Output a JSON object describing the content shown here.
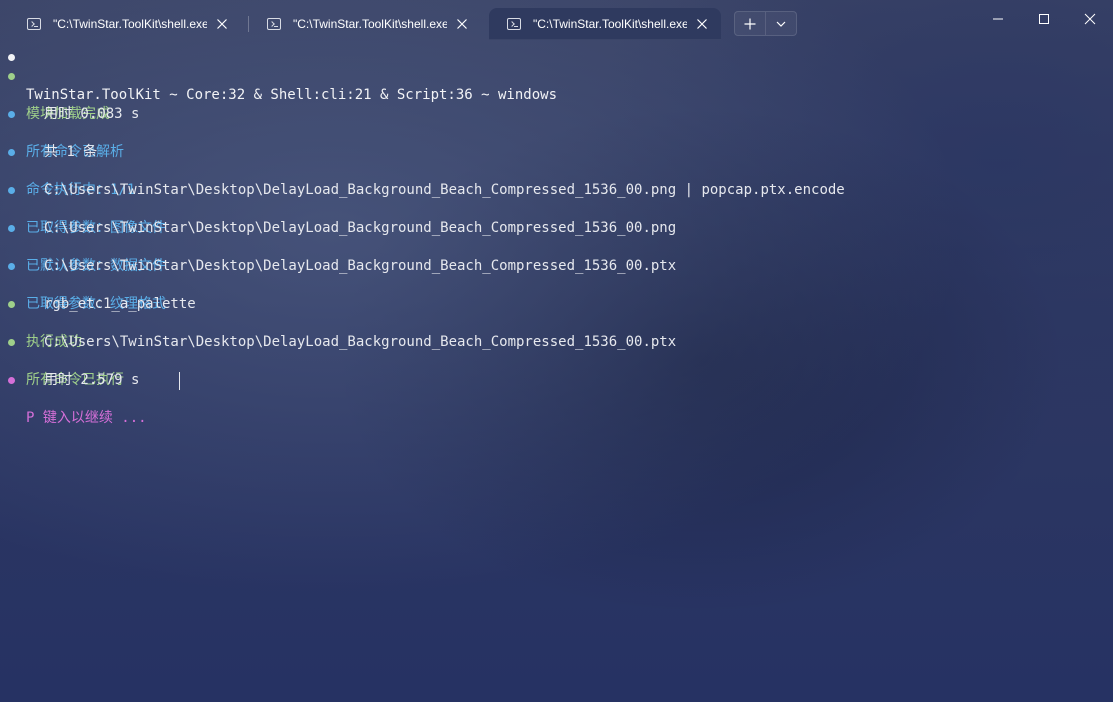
{
  "window": {
    "tabs": [
      {
        "title": "\"C:\\TwinStar.ToolKit\\shell.exe\"",
        "active": false
      },
      {
        "title": "\"C:\\TwinStar.ToolKit\\shell.exe\"",
        "active": false
      },
      {
        "title": "\"C:\\TwinStar.ToolKit\\shell.exe\"",
        "active": true
      }
    ],
    "icons": {
      "tab": "terminal-icon",
      "close": "close-icon",
      "new_tab": "plus-icon",
      "dropdown": "chevron-down-icon",
      "minimize": "minimize-icon",
      "maximize": "maximize-icon",
      "close_window": "close-icon"
    }
  },
  "colors": {
    "white": "#f2f3f6",
    "green": "#9fd08a",
    "blue": "#5aaee8",
    "magenta": "#d56fd8"
  },
  "terminal": {
    "lines": [
      {
        "kind": "head",
        "color": "white",
        "text": "TwinStar.ToolKit ~ Core:32 & Shell:cli:21 & Script:36 ~ windows"
      },
      {
        "kind": "head",
        "color": "green",
        "text": "模块加载完成"
      },
      {
        "kind": "sub",
        "text": "用时 0.083 s"
      },
      {
        "kind": "head",
        "color": "blue",
        "text": "所有命令已解析"
      },
      {
        "kind": "sub",
        "text": "共 1 条"
      },
      {
        "kind": "head",
        "color": "blue",
        "text": "命令执行中：1/1"
      },
      {
        "kind": "sub",
        "text": "C:\\Users\\TwinStar\\Desktop\\DelayLoad_Background_Beach_Compressed_1536_00.png | popcap.ptx.encode"
      },
      {
        "kind": "head",
        "color": "blue",
        "text": "已取得参数：图像文件"
      },
      {
        "kind": "sub",
        "text": "C:\\Users\\TwinStar\\Desktop\\DelayLoad_Background_Beach_Compressed_1536_00.png"
      },
      {
        "kind": "head",
        "color": "blue",
        "text": "已默认参数：数据文件"
      },
      {
        "kind": "sub",
        "text": "C:\\Users\\TwinStar\\Desktop\\DelayLoad_Background_Beach_Compressed_1536_00.ptx"
      },
      {
        "kind": "head",
        "color": "blue",
        "text": "已取得参数：纹理格式"
      },
      {
        "kind": "sub",
        "text": "rgb_etc1_a_palette"
      },
      {
        "kind": "head",
        "color": "green",
        "text": "执行成功"
      },
      {
        "kind": "sub",
        "text": "C:\\Users\\TwinStar\\Desktop\\DelayLoad_Background_Beach_Compressed_1536_00.ptx"
      },
      {
        "kind": "head",
        "color": "green",
        "text": "所有命令已执行"
      },
      {
        "kind": "sub",
        "text": "用时 2.579 s"
      },
      {
        "kind": "head",
        "color": "magenta",
        "text": "P 键入以继续 ..."
      }
    ]
  }
}
